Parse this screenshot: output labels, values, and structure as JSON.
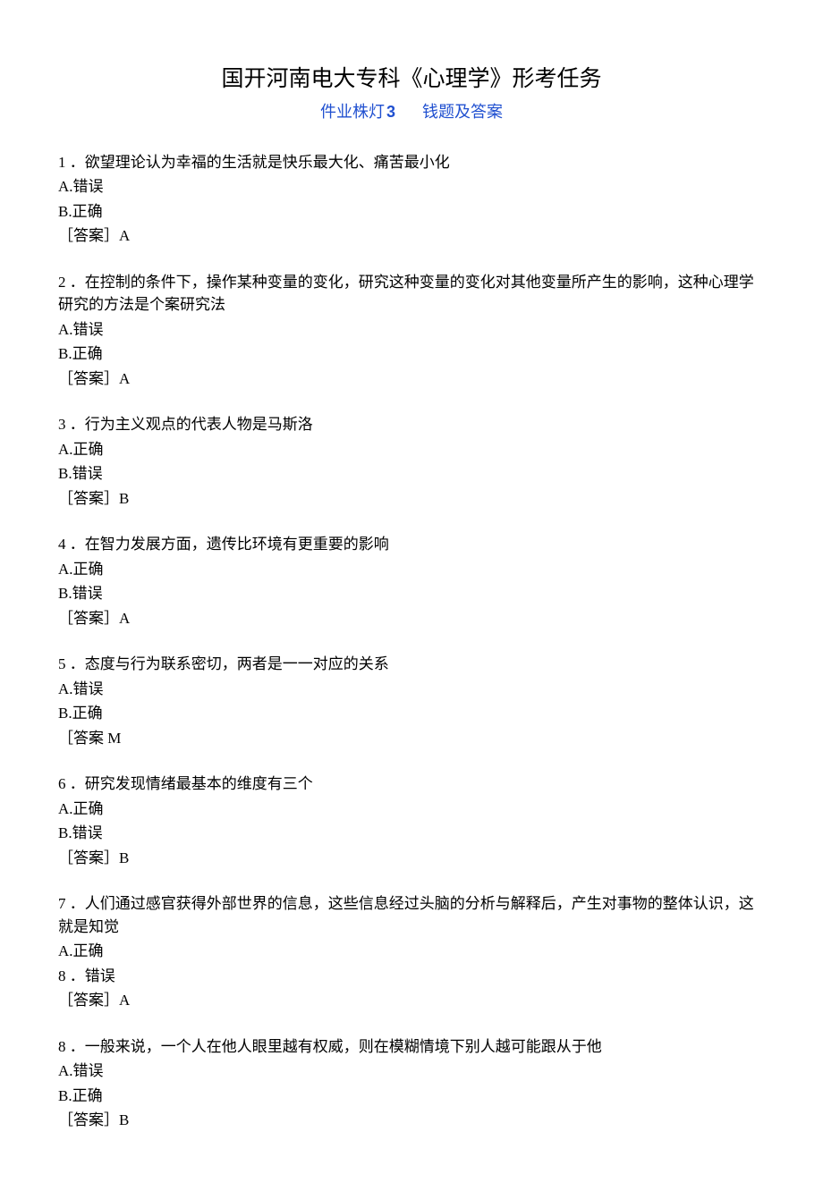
{
  "title": "国开河南电大专科《心理学》形考任务",
  "subtitle_part1": "件业株灯",
  "subtitle_num": "3",
  "subtitle_part2": "钱题及答案",
  "questions": [
    {
      "num": "1",
      "text": "．欲望理论认为幸福的生活就是快乐最大化、痛苦最小化",
      "optA": "A.错误",
      "optB": "B.正确",
      "answer": "［答案］A"
    },
    {
      "num": "2",
      "text": "．在控制的条件下，操作某种变量的变化，研究这种变量的变化对其他变量所产生的影响，这种心理学研究的方法是个案研究法",
      "optA": "A.错误",
      "optB": "B.正确",
      "answer": "［答案］A"
    },
    {
      "num": "3",
      "text": "．行为主义观点的代表人物是马斯洛",
      "optA": "A.正确",
      "optB": "B.错误",
      "answer": "［答案］B"
    },
    {
      "num": "4",
      "text": "．在智力发展方面，遗传比环境有更重要的影响",
      "optA": "A.正确",
      "optB": "B.错误",
      "answer": "［答案］A"
    },
    {
      "num": "5",
      "text": "．态度与行为联系密切，两者是一一对应的关系",
      "optA": "A.错误",
      "optB": "B.正确",
      "answer": "［答案 M"
    },
    {
      "num": "6",
      "text": "．研究发现情绪最基本的维度有三个",
      "optA": "A.正确",
      "optB": "B.错误",
      "answer": "［答案］B"
    },
    {
      "num": "7",
      "text": "．人们通过感官获得外部世界的信息，这些信息经过头脑的分析与解释后，产生对事物的整体认识，这就是知觉",
      "optA": "A.正确",
      "optB_prefix": "8",
      "optB": "．错误",
      "answer": "［答案］A"
    },
    {
      "num": "8",
      "text": "．一般来说，一个人在他人眼里越有权威，则在模糊情境下别人越可能跟从于他",
      "optA": "A.错误",
      "optB": "B.正确",
      "answer": "［答案］B"
    }
  ]
}
